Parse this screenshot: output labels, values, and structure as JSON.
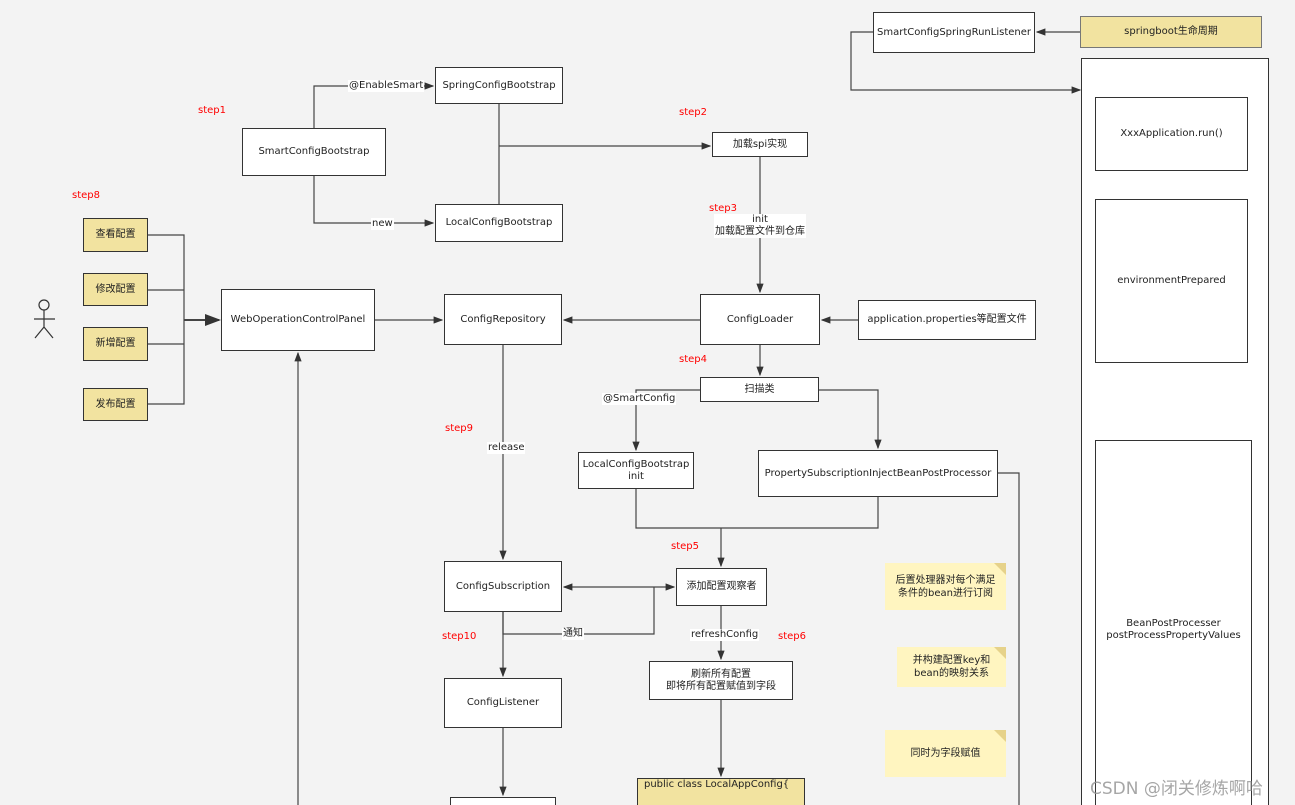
{
  "boxes": {
    "run_listener": "SmartConfigSpringRunListener",
    "lifecycle": "springboot生命周期",
    "app_run": "XxxApplication.run()",
    "env_prepared": "environmentPrepared",
    "bean_post": "BeanPostProcesser\npostProcessPropertyValues",
    "spring_bootstrap": "SpringConfigBootstrap",
    "smart_bootstrap": "SmartConfigBootstrap",
    "local_bootstrap": "LocalConfigBootstrap",
    "load_spi": "加载spi实现",
    "view_config": "查看配置",
    "edit_config": "修改配置",
    "add_config": "新增配置",
    "publish_config": "发布配置",
    "web_panel": "WebOperationControlPanel",
    "config_repository": "ConfigRepository",
    "config_loader": "ConfigLoader",
    "app_properties": "application.properties等配置文件",
    "scan_class": "扫描类",
    "local_bootstrap_init": "LocalConfigBootstrap\ninit",
    "property_processor": "PropertySubscriptionInjectBeanPostProcessor",
    "config_subscription": "ConfigSubscription",
    "add_observer": "添加配置观察者",
    "refresh_all": "刷新所有配置\n即将所有配置赋值到字段",
    "config_listener": "ConfigListener",
    "local_app_config": "public class LocalAppConfig{"
  },
  "edge_labels": {
    "enable_smart": "@EnableSmart",
    "new": "new",
    "init": "init\n加载配置文件到仓库",
    "smart_config": "@SmartConfig",
    "release": "release",
    "notify": "通知",
    "refresh_config": "refreshConfig"
  },
  "steps": {
    "s1": "step1",
    "s2": "step2",
    "s3": "step3",
    "s4": "step4",
    "s5": "step5",
    "s6": "step6",
    "s8": "step8",
    "s9": "step9",
    "s10": "step10"
  },
  "notes": {
    "n1": "后置处理器对每个满足\n条件的bean进行订阅",
    "n2": "并构建配置key和\nbean的映射关系",
    "n3": "同时为字段赋值"
  },
  "watermark": "CSDN @闭关修炼啊哈",
  "colors": {
    "step": "#ff0000",
    "yellow_box": "#f2e3a0",
    "note": "#fff5c0"
  }
}
